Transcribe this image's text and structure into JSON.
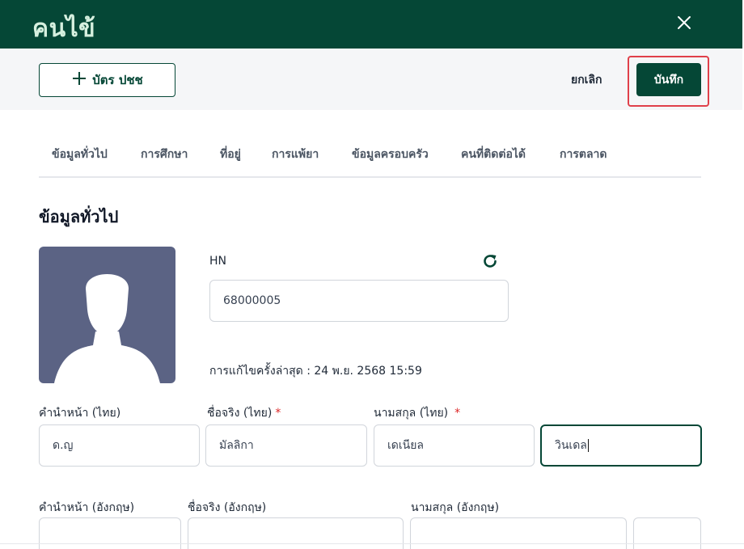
{
  "window": {
    "title": "คนไข้"
  },
  "toolbar": {
    "id_card_label": "บัตร ปชช",
    "cancel_label": "ยกเลิก",
    "save_label": "บันทึก"
  },
  "tabs": [
    {
      "label": "ข้อมูลทั่วไป"
    },
    {
      "label": "การศึกษา"
    },
    {
      "label": "ที่อยู่"
    },
    {
      "label": "การแพ้ยา"
    },
    {
      "label": "ข้อมูลครอบครัว"
    },
    {
      "label": "คนที่ติดต่อได้"
    },
    {
      "label": "การตลาด"
    }
  ],
  "section": {
    "title": "ข้อมูลทั่วไป"
  },
  "hn": {
    "label": "HN",
    "value": "68000005"
  },
  "last_edit": "การแก้ไขครั้งล่าสุด : 24 พ.ย. 2568 15:59",
  "thai_name": {
    "prefix_label": "คำนำหน้า (ไทย)",
    "prefix_value": "ด.ญ",
    "first_label": "ชื่อจริง (ไทย)",
    "first_value": "มัลลิกา",
    "last_label": "นามสกุล (ไทย)",
    "last_value": "เดเนียล",
    "extra_value": "วินเดล"
  },
  "eng_name": {
    "prefix_label": "คำนำหน้า (อังกฤษ)",
    "first_label": "ชื่อจริง (อังกฤษ)",
    "last_label": "นามสกุล (อังกฤษ)"
  },
  "colors": {
    "primary": "#054736",
    "title_text": "#d6f0df",
    "avatar_bg": "#5b6384",
    "highlight": "#e0404a",
    "required": "#dc2626"
  },
  "icons": {
    "close": "close-icon",
    "plus": "plus-icon",
    "refresh": "refresh-icon",
    "avatar": "person-silhouette-icon"
  }
}
